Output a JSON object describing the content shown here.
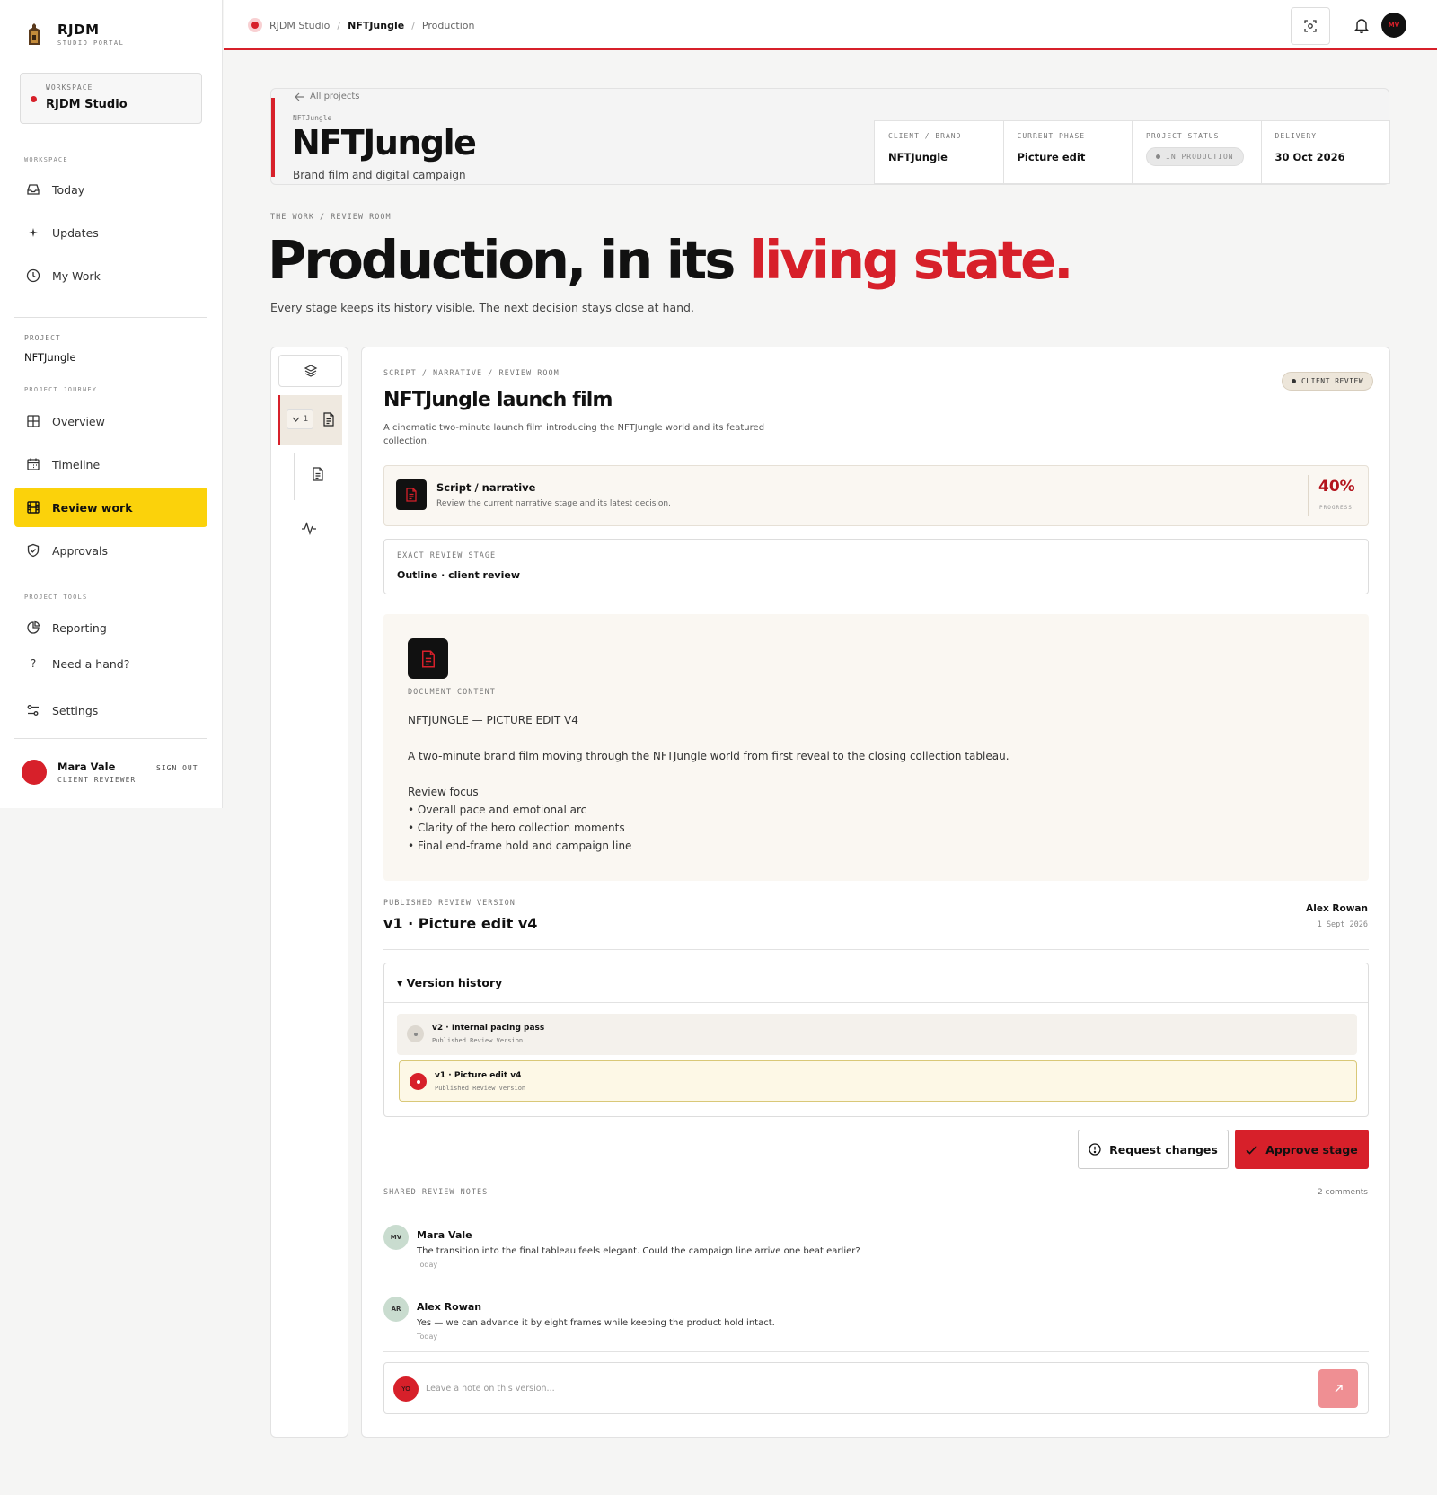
{
  "brand": {
    "name": "RJDM",
    "sub": "STUDIO PORTAL"
  },
  "workspace_card": {
    "label": "WORKSPACE",
    "name": "RJDM Studio"
  },
  "sidebar": {
    "section_workspace": "WORKSPACE",
    "items_workspace": [
      {
        "label": "Today",
        "icon": "inbox-icon"
      },
      {
        "label": "Updates",
        "icon": "sparkle-icon"
      },
      {
        "label": "My Work",
        "icon": "clock-icon"
      }
    ],
    "project_label": "PROJECT",
    "project_name": "NFTJungle",
    "section_journey": "PROJECT JOURNEY",
    "items_journey": [
      {
        "label": "Overview",
        "icon": "grid-icon"
      },
      {
        "label": "Timeline",
        "icon": "calendar-icon"
      },
      {
        "label": "Review work",
        "icon": "film-icon",
        "active": true
      },
      {
        "label": "Approvals",
        "icon": "shield-check-icon"
      }
    ],
    "section_tools": "PROJECT TOOLS",
    "items_tools": [
      {
        "label": "Reporting",
        "icon": "pie-chart-icon"
      },
      {
        "label": "Need a hand?",
        "icon": "question-icon"
      },
      {
        "label": "Settings",
        "icon": "sliders-icon"
      }
    ],
    "user": {
      "name": "Mara Vale",
      "role": "CLIENT REVIEWER",
      "signout": "SIGN OUT"
    }
  },
  "topbar": {
    "crumbs": [
      "RJDM Studio",
      "NFTJungle",
      "Production"
    ],
    "avatar_initials": "MV"
  },
  "project": {
    "back": "All projects",
    "tag": "NFTJungle",
    "title": "NFTJungle",
    "subtitle": "Brand film and digital campaign",
    "meta": {
      "client_label": "CLIENT / BRAND",
      "client": "NFTJungle",
      "phase_label": "CURRENT PHASE",
      "phase": "Picture edit",
      "status_label": "PROJECT STATUS",
      "status": "IN PRODUCTION",
      "delivery_label": "DELIVERY",
      "delivery": "30 Oct 2026"
    }
  },
  "hero": {
    "eyebrow": "THE WORK / REVIEW ROOM",
    "title_main": "Production, in its ",
    "title_accent": "living state.",
    "subtitle": "Every stage keeps its history visible. The next decision stays close at hand."
  },
  "rail": {
    "count": "1"
  },
  "review": {
    "eyebrow": "SCRIPT / NARRATIVE / REVIEW ROOM",
    "title": "NFTJungle launch film",
    "description": "A cinematic two-minute launch film introducing the NFTJungle world and its featured collection.",
    "badge": "CLIENT REVIEW",
    "stage": {
      "title": "Script / narrative",
      "subtitle": "Review the current narrative stage and its latest decision.",
      "progress": "40%",
      "progress_label": "PROGRESS"
    },
    "exact": {
      "label": "EXACT REVIEW STAGE",
      "value": "Outline · client review"
    },
    "document": {
      "label": "DOCUMENT CONTENT",
      "heading": "NFTJUNGLE — PICTURE EDIT V4",
      "paragraph": "A two-minute brand film moving through the NFTJungle world from first reveal to the closing collection tableau.",
      "focus_title": "Review focus",
      "focus_items": [
        "• Overall pace and emotional arc",
        "• Clarity of the hero collection moments",
        "• Final end-frame hold and campaign line"
      ]
    },
    "published": {
      "label": "PUBLISHED REVIEW VERSION",
      "version": "v1 · Picture edit v4",
      "author": "Alex Rowan",
      "date": "1 Sept 2026"
    },
    "history": {
      "title": "▾ Version history",
      "versions": [
        {
          "title": "v2 · Internal pacing pass",
          "sub": "Published Review Version"
        },
        {
          "title": "v1 · Picture edit v4",
          "sub": "Published Review Version"
        }
      ]
    },
    "actions": {
      "request": "Request changes",
      "approve": "Approve stage"
    },
    "notes": {
      "label": "SHARED REVIEW NOTES",
      "count": "2 comments",
      "comments": [
        {
          "initials": "MV",
          "name": "Mara Vale",
          "text": "The transition into the final tableau feels elegant. Could the campaign line arrive one beat earlier?",
          "time": "Today"
        },
        {
          "initials": "AR",
          "name": "Alex Rowan",
          "text": "Yes — we can advance it by eight frames while keeping the product hold intact.",
          "time": "Today"
        }
      ],
      "composer_initials": "YO",
      "composer_placeholder": "Leave a note on this version..."
    }
  },
  "colors": {
    "accent": "#d7202a",
    "highlight": "#fbd20b"
  }
}
